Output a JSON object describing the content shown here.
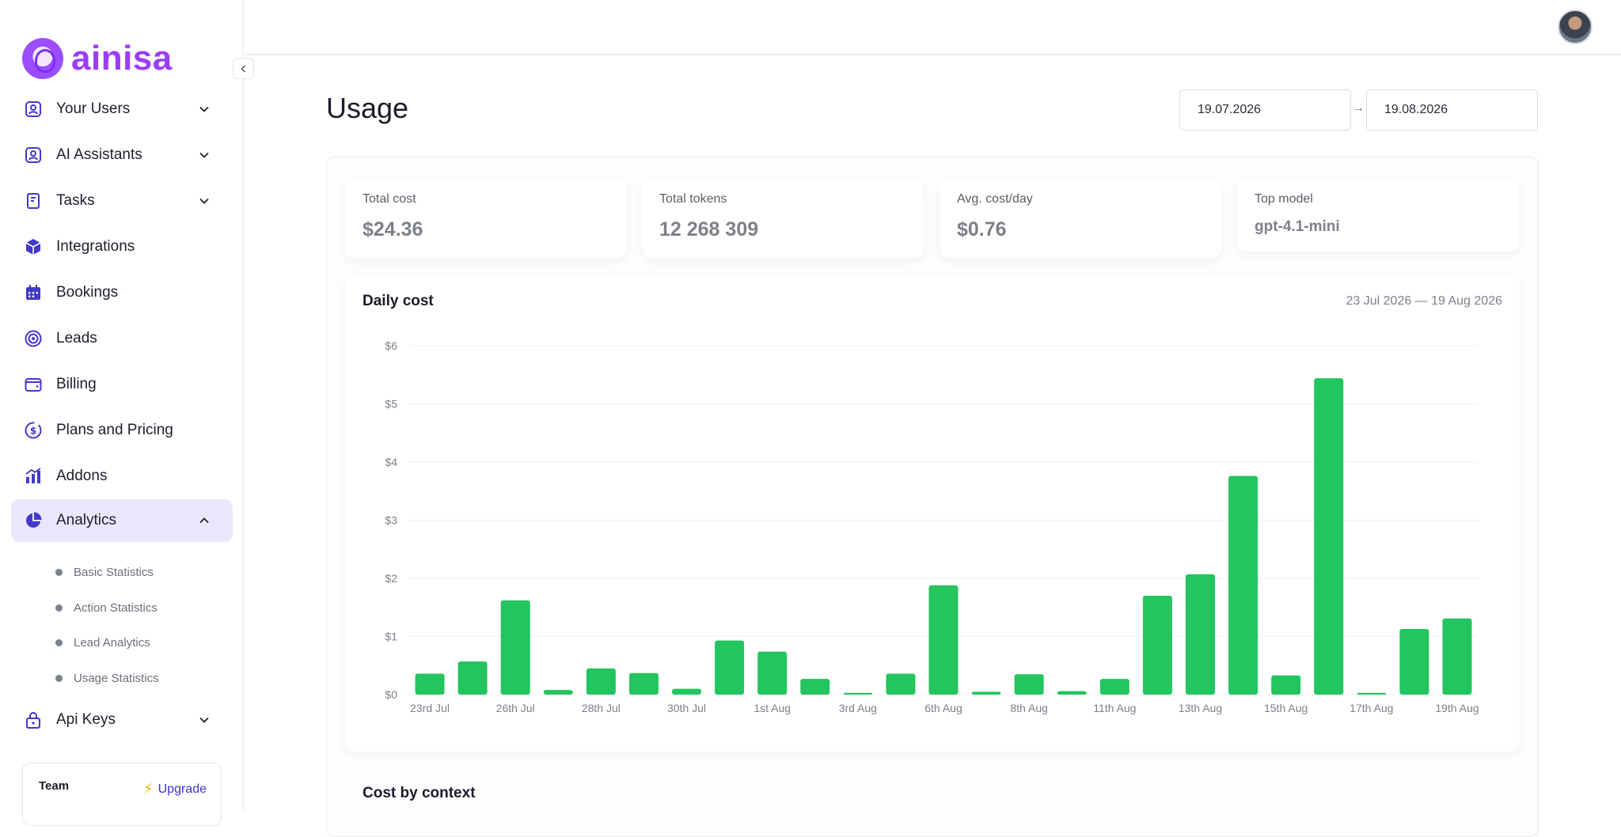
{
  "brand": {
    "name": "ainisa",
    "accent": "#9b3df5"
  },
  "sidebar": {
    "collapse_icon": "chevron-left-icon",
    "items": [
      {
        "label": "Your Users",
        "icon": "user-badge-icon",
        "expandable": true,
        "expanded": false
      },
      {
        "label": "AI Assistants",
        "icon": "user-badge-icon",
        "expandable": true,
        "expanded": false
      },
      {
        "label": "Tasks",
        "icon": "clipboard-icon",
        "expandable": true,
        "expanded": false
      },
      {
        "label": "Integrations",
        "icon": "box-icon",
        "expandable": false
      },
      {
        "label": "Bookings",
        "icon": "calendar-icon",
        "expandable": false
      },
      {
        "label": "Leads",
        "icon": "target-icon",
        "expandable": false
      },
      {
        "label": "Billing",
        "icon": "wallet-icon",
        "expandable": false
      },
      {
        "label": "Plans and Pricing",
        "icon": "dollar-circle-icon",
        "expandable": false
      },
      {
        "label": "Addons",
        "icon": "bar-chart-icon",
        "expandable": false
      },
      {
        "label": "Analytics",
        "icon": "pie-chart-icon",
        "expandable": true,
        "expanded": true,
        "active": true
      },
      {
        "label": "Api Keys",
        "icon": "lock-icon",
        "expandable": true,
        "expanded": false
      }
    ],
    "analytics_sub": [
      "Basic Statistics",
      "Action Statistics",
      "Lead Analytics",
      "Usage Statistics"
    ],
    "team": {
      "name": "Team",
      "upgrade_label": "Upgrade"
    }
  },
  "page": {
    "title": "Usage",
    "date_from": "19.07.2026",
    "date_to": "19.08.2026"
  },
  "stats": [
    {
      "label": "Total cost",
      "value": "$24.36"
    },
    {
      "label": "Total tokens",
      "value": "12 268 309"
    },
    {
      "label": "Avg. cost/day",
      "value": "$0.76"
    },
    {
      "label": "Top model",
      "value": "gpt-4.1-mini"
    }
  ],
  "chart_title": "Daily cost",
  "chart_range_label": "23 Jul 2026 — 19 Aug 2026",
  "chart_data": {
    "type": "bar",
    "title": "Daily cost",
    "color": "#22c55e",
    "categories": [
      "23rd Jul",
      "24th Jul",
      "26th Jul",
      "27th Jul",
      "28th Jul",
      "29th Jul",
      "30th Jul",
      "31st Jul",
      "1st Aug",
      "2nd Aug",
      "3rd Aug",
      "4th Aug",
      "6th Aug",
      "7th Aug",
      "8th Aug",
      "9th Aug",
      "11th Aug",
      "12th Aug",
      "13th Aug",
      "14th Aug",
      "15th Aug",
      "16th Aug",
      "17th Aug",
      "18th Aug",
      "19th Aug"
    ],
    "values": [
      0.36,
      0.57,
      1.62,
      0.08,
      0.45,
      0.37,
      0.1,
      0.93,
      0.74,
      0.27,
      0.03,
      0.36,
      1.88,
      0.05,
      0.35,
      0.06,
      0.27,
      1.7,
      2.07,
      3.76,
      0.33,
      5.44,
      0.03,
      1.13,
      1.31
    ],
    "x_tick_labels": [
      "23rd Jul",
      "26th Jul",
      "28th Jul",
      "30th Jul",
      "1st Aug",
      "3rd Aug",
      "6th Aug",
      "8th Aug",
      "11th Aug",
      "13th Aug",
      "15th Aug",
      "17th Aug",
      "19th Aug"
    ],
    "y_ticks": [
      "$0",
      "$1",
      "$2",
      "$3",
      "$4",
      "$5",
      "$6"
    ],
    "ylim": [
      0,
      6
    ],
    "grid": true
  },
  "section2_title": "Cost by context"
}
